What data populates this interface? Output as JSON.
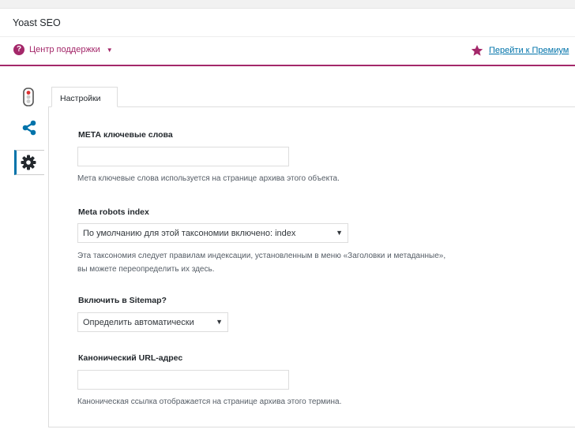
{
  "metabox": {
    "title": "Yoast SEO"
  },
  "helpbar": {
    "label": "Центр поддержки",
    "premium_link": "Перейти к Премиум"
  },
  "sidenav": {
    "items": [
      {
        "icon": "traffic-light-icon"
      },
      {
        "icon": "share-icon"
      },
      {
        "icon": "gear-icon",
        "active": true
      }
    ]
  },
  "tab": {
    "label": "Настройки"
  },
  "fields": {
    "meta_keywords": {
      "label": "МЕТА ключевые слова",
      "value": "",
      "description": "Мета ключевые слова используется на странице архива этого объекта."
    },
    "robots_index": {
      "label": "Meta robots index",
      "value": "По умолчанию для этой таксономии включено: index",
      "description_line1": "Эта таксономия следует правилам индексации, установленным в меню «Заголовки и метаданные»,",
      "description_line2": "вы можете переопределить их здесь."
    },
    "sitemap": {
      "label": "Включить в Sitemap?",
      "value": "Определить автоматически"
    },
    "canonical": {
      "label": "Канонический URL-адрес",
      "value": "",
      "description": "Каноническая ссылка отображается на странице архива этого термина."
    }
  },
  "colors": {
    "brand": "#a4286a",
    "link": "#0073aa",
    "active_tab_accent": "#0073aa"
  }
}
